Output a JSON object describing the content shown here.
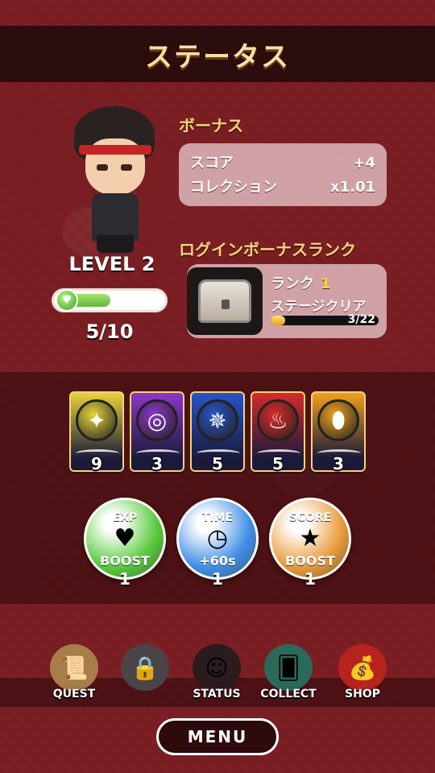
{
  "title": "ステータス",
  "player": {
    "level_label": "LEVEL 2",
    "exp_progress": "5/10",
    "exp_fraction": 0.5
  },
  "bonus": {
    "heading": "ボーナス",
    "rows": [
      {
        "label": "スコア",
        "value": "+4"
      },
      {
        "label": "コレクション",
        "value": "x1.01"
      }
    ]
  },
  "login_rank": {
    "heading": "ログインボーナスランク",
    "rank_label": "ランク",
    "rank_value": "1",
    "stage_label": "ステージクリア",
    "stage_progress": "3/22",
    "stage_fraction": 0.136
  },
  "element_cards": [
    {
      "name": "light",
      "icon": "shuriken-icon",
      "symbol": "✦",
      "count": "9",
      "color": "#e6d43a"
    },
    {
      "name": "wind",
      "icon": "swirl-icon",
      "symbol": "◎",
      "count": "3",
      "color": "#8a37c9"
    },
    {
      "name": "water",
      "icon": "star-compass-icon",
      "symbol": "✵",
      "count": "5",
      "color": "#2854c9"
    },
    {
      "name": "fire",
      "icon": "flame-icon",
      "symbol": "♨",
      "count": "5",
      "color": "#d82a2a"
    },
    {
      "name": "earth",
      "icon": "drop-icon",
      "symbol": "⬮",
      "count": "3",
      "color": "#f0a01e"
    }
  ],
  "boosts": [
    {
      "name": "exp",
      "top": "EXP",
      "bottom": "BOOST",
      "icon": "heart-icon",
      "symbol": "♥",
      "count": "1",
      "color": "#57c93b"
    },
    {
      "name": "time",
      "top": "TIME",
      "bottom": "+60s",
      "icon": "clock-icon",
      "symbol": "◷",
      "count": "1",
      "color": "#3f8ee6"
    },
    {
      "name": "score",
      "top": "SCORE",
      "bottom": "BOOST",
      "icon": "star-icon",
      "symbol": "★",
      "count": "1",
      "color": "#e99a3a"
    }
  ],
  "nav": [
    {
      "name": "quest",
      "label": "QUEST",
      "icon": "scroll-icon",
      "symbol": "📜"
    },
    {
      "name": "locked",
      "label": "",
      "icon": "padlock-icon",
      "symbol": "🔒"
    },
    {
      "name": "status",
      "label": "STATUS",
      "icon": "avatar-icon",
      "symbol": "☺"
    },
    {
      "name": "collect",
      "label": "COLLECT",
      "icon": "cards-icon",
      "symbol": "🂠"
    },
    {
      "name": "shop",
      "label": "SHOP",
      "icon": "treasure-chest-icon",
      "symbol": "💰"
    }
  ],
  "menu_label": "MENU"
}
